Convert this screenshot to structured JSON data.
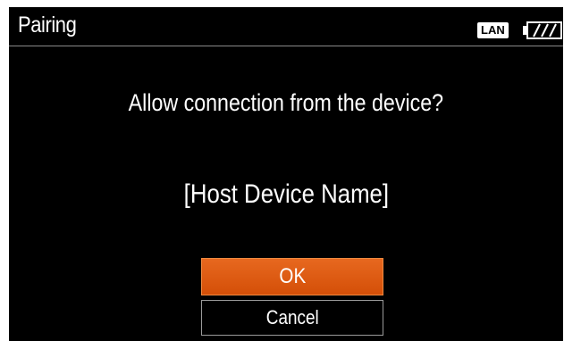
{
  "header": {
    "title": "Pairing",
    "lan_badge": "LAN"
  },
  "dialog": {
    "message": "Allow connection from the device?",
    "device_name": "[Host Device Name]",
    "ok_label": "OK",
    "cancel_label": "Cancel"
  },
  "icons": {
    "lan": "lan-icon",
    "battery": "battery-icon"
  },
  "colors": {
    "background": "#000000",
    "ok_button": "#e05a10",
    "text": "#ffffff"
  }
}
